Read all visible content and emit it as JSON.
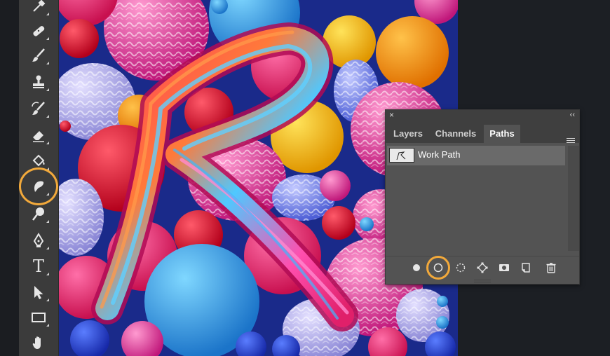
{
  "toolbar": {
    "tools": [
      {
        "name": "eyedropper-tool-icon"
      },
      {
        "name": "spot-healing-brush-tool-icon"
      },
      {
        "name": "brush-tool-icon"
      },
      {
        "name": "clone-stamp-tool-icon"
      },
      {
        "name": "history-brush-tool-icon"
      },
      {
        "name": "eraser-tool-icon"
      },
      {
        "name": "paint-bucket-tool-icon"
      },
      {
        "name": "smudge-tool-icon",
        "highlighted": true
      },
      {
        "name": "dodge-tool-icon"
      },
      {
        "name": "pen-tool-icon"
      },
      {
        "name": "type-tool-icon",
        "label": "T"
      },
      {
        "name": "path-selection-tool-icon"
      },
      {
        "name": "rectangle-tool-icon"
      },
      {
        "name": "hand-tool-icon"
      }
    ]
  },
  "panel": {
    "close_glyph": "×",
    "collapse_glyph": "‹‹",
    "tabs": [
      {
        "label": "Layers"
      },
      {
        "label": "Channels"
      },
      {
        "label": "Paths",
        "active": true
      }
    ],
    "paths": [
      {
        "name": "Work Path",
        "selected": true
      }
    ],
    "footer_buttons": [
      {
        "name": "fill-path-icon"
      },
      {
        "name": "stroke-path-icon",
        "highlighted": true
      },
      {
        "name": "load-path-as-selection-icon"
      },
      {
        "name": "make-work-path-icon"
      },
      {
        "name": "add-mask-icon"
      },
      {
        "name": "create-new-path-icon"
      },
      {
        "name": "delete-path-icon"
      }
    ]
  },
  "colors": {
    "highlight_ring": "#f2a93b",
    "toolbar_bg": "#3b3b3b",
    "panel_bg": "#535353",
    "canvas_bg": "#1a2a8a"
  }
}
